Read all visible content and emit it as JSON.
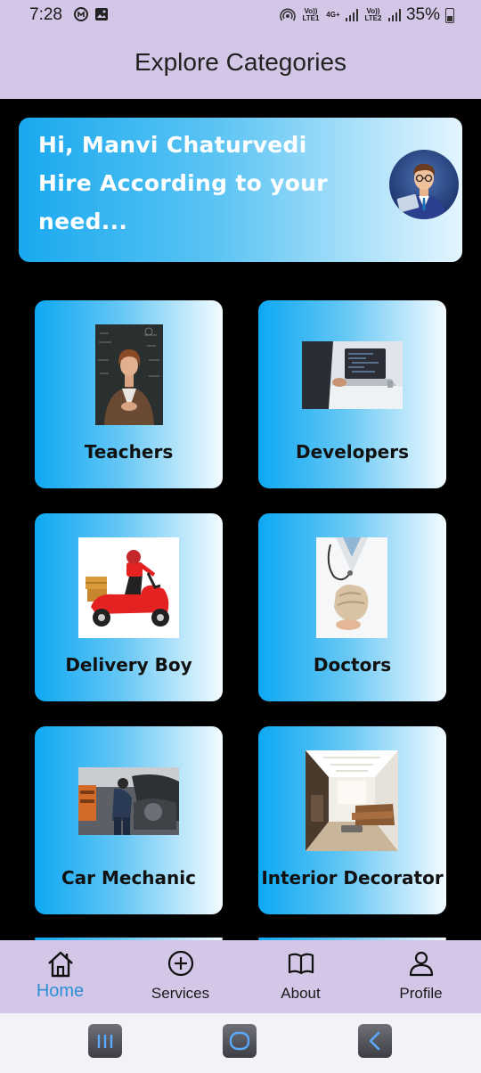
{
  "status_bar": {
    "time": "7:28",
    "network_labels": [
      "Vo)) LTE1",
      "4G+",
      "Vo)) LTE2"
    ],
    "battery": "35%"
  },
  "app_bar": {
    "title": "Explore Categories"
  },
  "banner": {
    "line1": "Hi, Manvi Chaturvedi",
    "line2": "Hire According to your",
    "line3": "need..."
  },
  "categories": [
    {
      "label": "Teachers"
    },
    {
      "label": "Developers"
    },
    {
      "label": "Delivery Boy"
    },
    {
      "label": "Doctors"
    },
    {
      "label": "Car Mechanic"
    },
    {
      "label": "Interior Decorator"
    }
  ],
  "bottom_nav": {
    "items": [
      {
        "label": "Home",
        "icon": "home-icon",
        "active": true
      },
      {
        "label": "Services",
        "icon": "add-circle-icon"
      },
      {
        "label": "About",
        "icon": "book-icon"
      },
      {
        "label": "Profile",
        "icon": "person-icon"
      }
    ],
    "active_color": "#2f8fd6"
  },
  "colors": {
    "app_bar_bg": "#d3c6e6",
    "card_gradient_start": "#0ea8f3",
    "card_gradient_end": "#f3fbff"
  }
}
